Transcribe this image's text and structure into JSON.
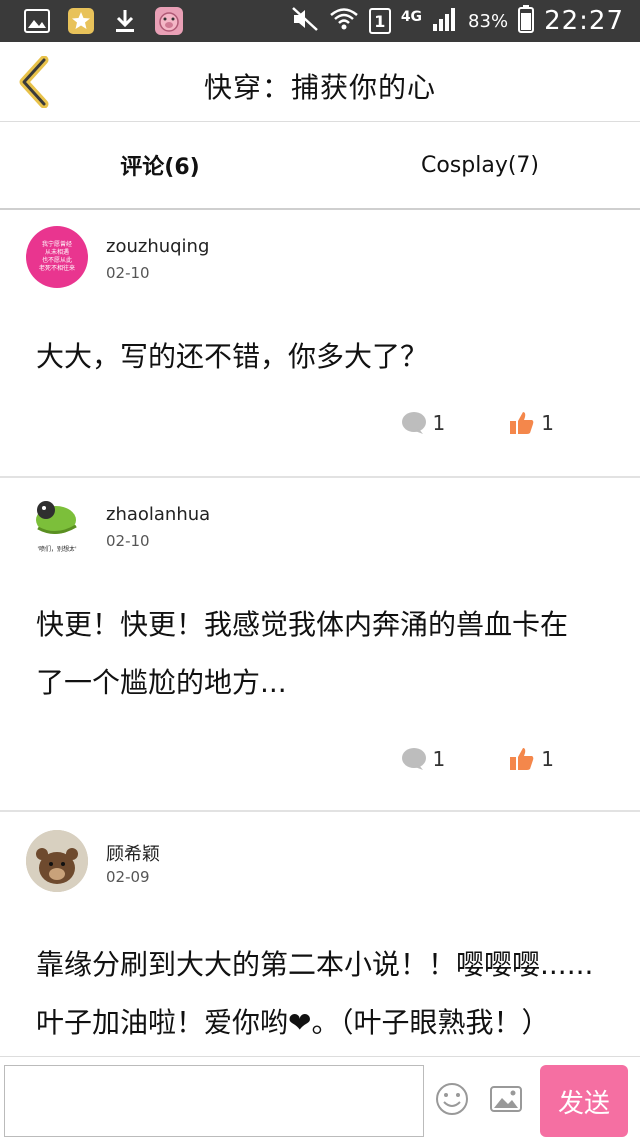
{
  "status_bar": {
    "signal_label": "4G",
    "sim_label": "1",
    "battery": "83%",
    "time": "22:27"
  },
  "nav": {
    "title": "快穿：捕获你的心"
  },
  "tabs": [
    {
      "label": "评论(6)",
      "active": true
    },
    {
      "label": "Cosplay(7)",
      "active": false
    }
  ],
  "comments": [
    {
      "username": "zouzhuqing",
      "date": "02-10",
      "avatar_text": [
        "我宁愿曾经",
        "从未相遇",
        "也不愿从此",
        "老死不相往来"
      ],
      "text_lines": [
        "大大，写的还不错，你多大了？"
      ],
      "reply_count": "1",
      "like_count": "1"
    },
    {
      "username": "zhaolanhua",
      "date": "02-10",
      "avatar_text": [
        "'喷们，别想太'"
      ],
      "text_lines": [
        "快更！快更！我感觉我体内奔涌的兽血卡在",
        "了一个尴尬的地方..."
      ],
      "reply_count": "1",
      "like_count": "1"
    },
    {
      "username": "顾希颖",
      "date": "02-09",
      "text_lines": [
        "靠缘分刷到大大的第二本小说！！嘤嘤嘤......",
        "叶子加油啦！爱你哟❤。（叶子眼熟我！）"
      ]
    }
  ],
  "input_bar": {
    "placeholder": "",
    "send_label": "发送"
  },
  "colors": {
    "accent_pink": "#f56fa2",
    "like_orange": "#f4874b",
    "reply_gray": "#bdbdbd"
  }
}
